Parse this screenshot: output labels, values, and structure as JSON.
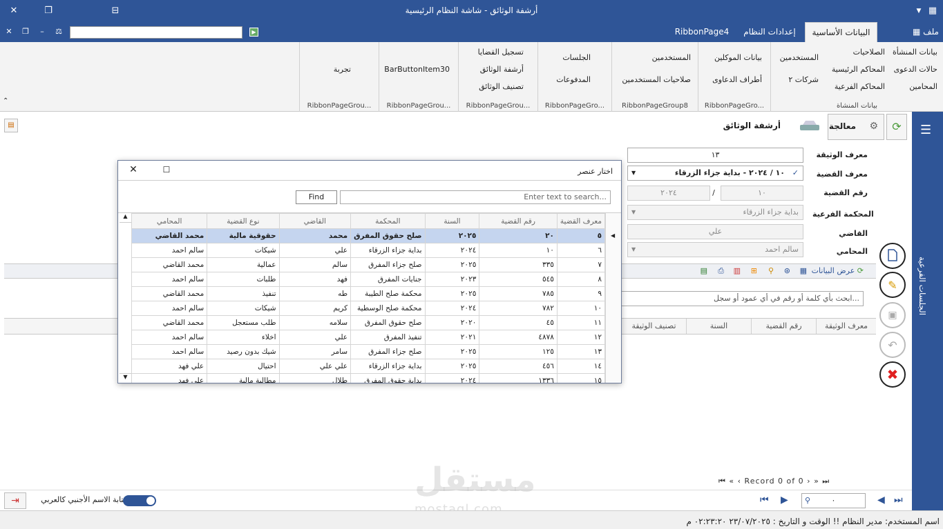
{
  "window": {
    "title": "أرشفة الوثائق - شاشة النظام الرئيسية"
  },
  "ribbon_tabs": [
    {
      "label": "ملف",
      "active": false
    },
    {
      "label": "البيانات الأساسية",
      "active": true
    },
    {
      "label": "إعدادات النظام",
      "active": false
    },
    {
      "label": "RibbonPage4",
      "active": false
    }
  ],
  "ribbon_groups": {
    "g1": {
      "caption": "بيانات المنشأة",
      "items": [
        "بيانات المنشأة",
        "الصلاحيات",
        "المستخدمين",
        "حالات الدعوى",
        "المحاكم الرئيسية",
        "المحامين",
        "المحاكم الفرعية",
        "شركات ٢"
      ]
    },
    "g2": {
      "caption": "RibbonPageGro...",
      "items": [
        "بيانات الموكلين",
        "أطراف الدعاوى"
      ]
    },
    "g3": {
      "caption": "RibbonPageGroup8",
      "items": [
        "المستخدمين",
        "صلاحيات المستخدمين"
      ]
    },
    "g4": {
      "caption": "RibbonPageGro...",
      "items": [
        "الجلسات",
        "المدفوعات"
      ]
    },
    "g5": {
      "caption": "RibbonPageGrou...",
      "items": [
        "تسجيل القضايا",
        "أرشفة الوثائق",
        "تصنيف الوثائق"
      ]
    },
    "g6": {
      "caption": "RibbonPageGrou...",
      "items": [
        "BarButtonItem30"
      ]
    },
    "g7": {
      "caption": "RibbonPageGrou...",
      "items": [
        "تجربة"
      ]
    }
  },
  "side_panel": {
    "label": "الجلسات الفرعية"
  },
  "doc_tab": {
    "title": "أرشفة الوثائق",
    "process_label": "معالجة"
  },
  "form": {
    "doc_id_label": "معرف الوثيقة",
    "doc_id": "١٣",
    "case_id_label": "معرف القضية",
    "case_id": "١٠ / ٢٠٢٤ - بداية جزاء الزرقاء",
    "case_no_label": "رقم القضية",
    "case_no": "١٠",
    "case_year": "٢٠٢٤",
    "sep": "/",
    "branch_court_label": "المحكمة الفرعية",
    "branch_court": "بداية جزاء الزرقاء",
    "judge_label": "القاضي",
    "judge": "علي",
    "lawyer_label": "المحامي",
    "lawyer": "سالم احمد"
  },
  "toolbar2": {
    "show_data": "عرض البيانات"
  },
  "grid_search": {
    "placeholder": "ابحث بأي كلمة أو رقم في أي عمود أو سجل..."
  },
  "main_grid": {
    "columns": [
      "معرف الوثيقة",
      "رقم القضية",
      "السنة",
      "تصنيف الوثيقة"
    ]
  },
  "nav": {
    "record_text": "Record 0 of 0"
  },
  "pager": {
    "value": "٠"
  },
  "bottom": {
    "toggle_label": "كتابة الاسم الأجنبي كالعربي"
  },
  "status": {
    "text": "اسم المستخدم: مدير النظام !! الوقت و التاريخ : ٢٣/٠٧/٢٠٢٥ ٠٢:٢٣:٢٠ م"
  },
  "watermark": {
    "text": "مستقل",
    "sub": "mostaql.com"
  },
  "dialog": {
    "title": "اختار عنصر",
    "find_button": "Find",
    "search_placeholder": "Enter text to search...",
    "columns": [
      "معرف القضية",
      "رقم القضية",
      "السنة",
      "المحكمة",
      "القاضي",
      "نوع القضية",
      "المحامي"
    ],
    "rows": [
      [
        "٥",
        "٢٠",
        "٢٠٢٥",
        "صلح حقوق المفرق",
        "محمد",
        "حقوقية مالية",
        "محمد القاضي"
      ],
      [
        "٦",
        "١٠",
        "٢٠٢٤",
        "بداية جزاء الزرقاء",
        "علي",
        "شيكات",
        "سالم احمد"
      ],
      [
        "٧",
        "٣٣٥",
        "٢٠٢٥",
        "صلح جزاء المفرق",
        "سالم",
        "عمالية",
        "محمد القاضي"
      ],
      [
        "٨",
        "٥٤٥",
        "٢٠٢٣",
        "جنايات المفرق",
        "فهد",
        "طلبات",
        "سالم احمد"
      ],
      [
        "٩",
        "٧٨٥",
        "٢٠٢٥",
        "محكمة صلح الطيبة",
        "طه",
        "تنفيذ",
        "محمد القاضي"
      ],
      [
        "١٠",
        "٧٨٢",
        "٢٠٢٤",
        "محكمة صلح الوسطية",
        "كريم",
        "شيكات",
        "سالم احمد"
      ],
      [
        "١١",
        "٤٥",
        "٢٠٢٠",
        "صلح حقوق المفرق",
        "سلامه",
        "طلب مستعجل",
        "محمد القاضي"
      ],
      [
        "١٢",
        "٤٨٧٨",
        "٢٠٢١",
        "تنفيذ المفرق",
        "علي",
        "اخلاء",
        "سالم احمد"
      ],
      [
        "١٣",
        "١٢٥",
        "٢٠٢٥",
        "صلح جزاء المفرق",
        "سامر",
        "شيك بدون رصيد",
        "سالم احمد"
      ],
      [
        "١٤",
        "٤٥٦",
        "٢٠٢٥",
        "بداية جزاء الزرقاء",
        "علي علي",
        "احتيال",
        "علي فهد"
      ],
      [
        "١٥",
        "١٣٣٦",
        "٢٠٢٤",
        "بداية حقوق المفرق",
        "طلال",
        "مطالبة مالية",
        "علي فهد"
      ]
    ]
  },
  "colors": {
    "primary": "#2f5597",
    "selected_row": "#c5d5ef",
    "close_red": "#e02020"
  }
}
